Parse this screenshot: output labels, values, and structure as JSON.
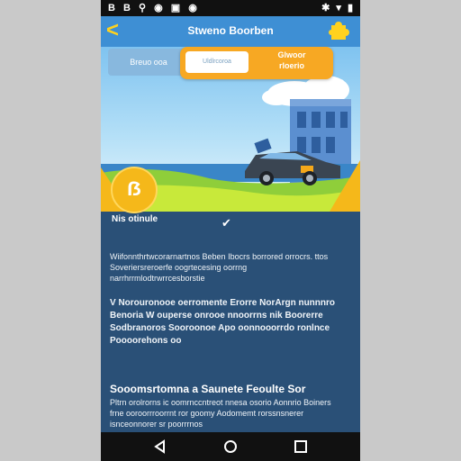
{
  "status_bar": {
    "left_icons_text": "B B ⚲ ◉ ▣ ◉",
    "right_icons_text": "✱ ▾ ▮"
  },
  "app_bar": {
    "back_glyph": "<",
    "title": "Stweno Boorben",
    "badge_icon": "puzzle-icon"
  },
  "hero": {
    "segment_left_label": "Breuo ooa",
    "input_placeholder": "Uldlrcoroa",
    "cta_label": "Glwoor\nrloerio",
    "coin_label": "ẞ"
  },
  "content": {
    "section_heading": "Nis otinule",
    "paragraph_1": "Wiifonnthrtwcorarnartnos Beben Ibocrs borrored orrocrs. ttos Soveriersreroerfe oogrtecesing oorrng narrhrrmlodtrwrrcesborstie",
    "paragraph_2": "V Norouronooe oerromente Erorre NorArgn nunnnro Benoria W ouperse onrooe nnoorrns nik Boorerre Sodbranoros Sooroonoe Apo oonnooorrdo ronlnce Poooorehons oo",
    "subheading": "Sooomsrtomna a Saunete Feoulte Sor",
    "paragraph_3": "Pltrn orolrorns ic oomrnccntreot nnesa osorio Aonnrio Boiners frne ooroorrroorrnt ror goomy Aodomemt rorssnsnerer isnceonnorer sr poorrrnos"
  },
  "nav": {
    "back_icon": "back-triangle-icon",
    "home_icon": "home-circle-icon",
    "recents_icon": "recents-square-icon"
  },
  "colors": {
    "app_bar": "#3e8fd4",
    "accent_yellow": "#ffd21f",
    "cta_orange": "#f7a823",
    "content_bg": "#2a5077"
  }
}
